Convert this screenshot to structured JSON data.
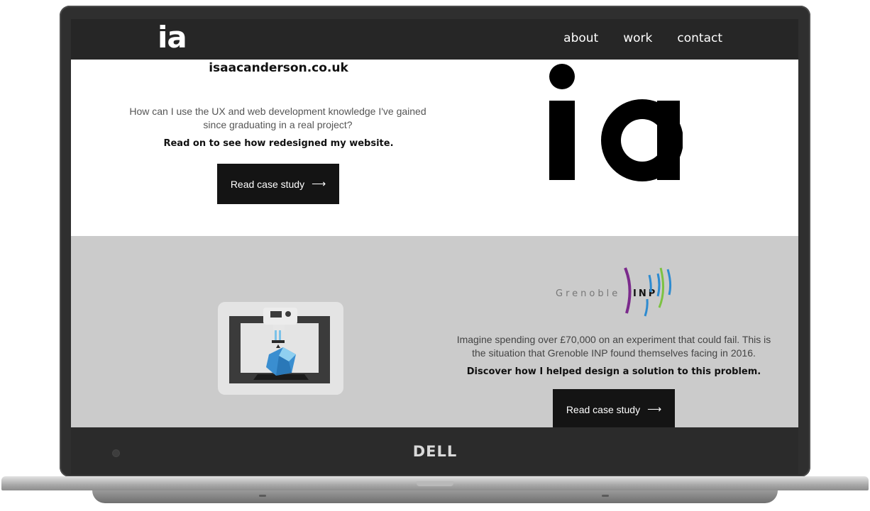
{
  "device": {
    "brand": "DELL"
  },
  "nav": {
    "logo": "ia",
    "links": [
      "about",
      "work",
      "contact"
    ]
  },
  "hero": {
    "site_name": "isaacanderson.co.uk",
    "question": "How can I use the UX and web development knowledge I've gained since graduating in a real project?",
    "bold_line": "Read on to see how redesigned my website.",
    "button_label": "Read case study",
    "button_arrow": "⟶",
    "big_logo_text": "ia"
  },
  "project": {
    "logo_text": "Grenoble",
    "logo_mark": "INP",
    "description": "Imagine spending over £70,000 on an experiment that could fail. This is the situation that Grenoble INP found themselves facing in 2016.",
    "bold_line": "Discover how I helped design a solution to this problem.",
    "button_label": "Read case study",
    "button_arrow": "⟶"
  },
  "colors": {
    "nav_bg": "#262626",
    "project_bg": "#cbcbcb",
    "button_bg": "#141414",
    "inp_purple": "#7b2a8c",
    "inp_blue": "#2e8bd0",
    "inp_green": "#7cc242"
  }
}
